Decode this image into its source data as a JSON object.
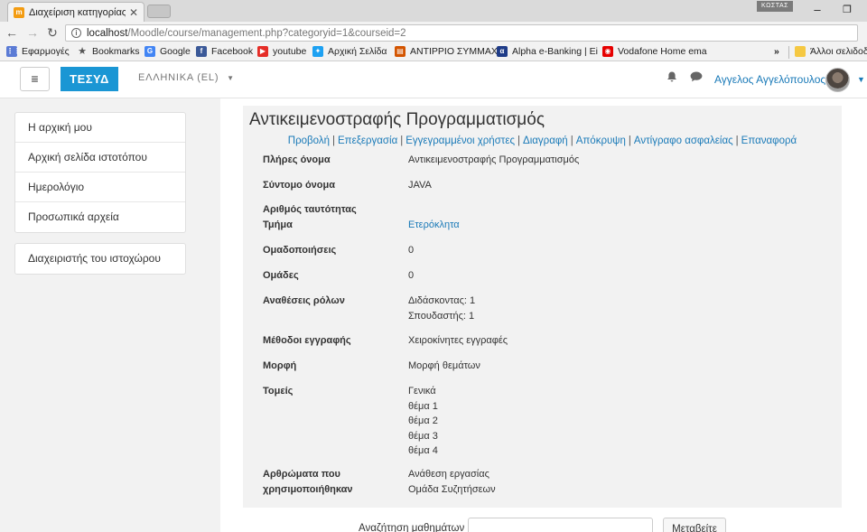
{
  "browser": {
    "tab_title": "Διαχείριση κατηγορίας κ",
    "profile_name": "ΚΩΣΤΑΣ",
    "url_host": "localhost",
    "url_path": "/Moodle/course/management.php?categoryid=1&courseid=2",
    "bookmarks": [
      {
        "label": "Εφαρμογές",
        "icon": "apps-grid-icon",
        "color": "#5b7bd5"
      },
      {
        "label": "Bookmarks",
        "icon": "star-icon",
        "color": "#555555"
      },
      {
        "label": "Google",
        "icon": "google-icon",
        "color": "#4285f4"
      },
      {
        "label": "Facebook",
        "icon": "facebook-icon",
        "color": "#3b5998"
      },
      {
        "label": "youtube",
        "icon": "youtube-icon",
        "color": "#e52d27"
      },
      {
        "label": "Αρχική Σελίδα",
        "icon": "twitter-icon",
        "color": "#1da1f2"
      },
      {
        "label": "ΑΝΤΙΡΡΙΟ ΣΥΜΜΑΧΙΑ",
        "icon": "folder-doc-icon",
        "color": "#d35400"
      },
      {
        "label": "Alpha e-Banking | Ei",
        "icon": "alpha-bank-icon",
        "color": "#1f3c88"
      },
      {
        "label": "Vodafone Home ema",
        "icon": "vodafone-icon",
        "color": "#e60000"
      }
    ],
    "overflow_label": "»",
    "other_bookmarks": "Άλλοι σελιδοδ"
  },
  "navbar": {
    "menu_icon": "≡",
    "brand": "ΤΕΣΥΔ",
    "language": "ΕΛΛΗΝΙΚΑ (EL)",
    "user_name": "Αγγελος Αγγελόπουλος"
  },
  "sidebar": {
    "items": [
      "Η αρχική μου",
      "Αρχική σελίδα ιστοτόπου",
      "Ημερολόγιο",
      "Προσωπικά αρχεία"
    ],
    "admin_item": "Διαχειριστής του ιστοχώρου"
  },
  "course": {
    "title": "Αντικειμενοστραφής Προγραμματισμός",
    "actions": [
      "Προβολή",
      "Επεξεργασία",
      "Εγγεγραμμένοι χρήστες",
      "Διαγραφή",
      "Απόκρυψη",
      "Αντίγραφο ασφαλείας",
      "Επαναφορά"
    ],
    "action_separator": "|",
    "fields": {
      "fullname": {
        "label": "Πλήρες όνομα",
        "value": "Αντικειμενοστραφής Προγραμματισμός"
      },
      "shortname": {
        "label": "Σύντομο όνομα",
        "value": "JAVA"
      },
      "idnumber": {
        "label": "Αριθμός ταυτότητας",
        "value": ""
      },
      "category": {
        "label": "Τμήμα",
        "value": "Ετερόκλητα"
      },
      "groupings": {
        "label": "Ομαδοποιήσεις",
        "value": "0"
      },
      "groups": {
        "label": "Ομάδες",
        "value": "0"
      },
      "roles": {
        "label": "Αναθέσεις ρόλων",
        "values": [
          "Διδάσκοντας: 1",
          "Σπουδαστής: 1"
        ]
      },
      "enrolment": {
        "label": "Μέθοδοι εγγραφής",
        "value": "Χειροκίνητες εγγραφές"
      },
      "format": {
        "label": "Μορφή",
        "value": "Μορφή θεμάτων"
      },
      "sections": {
        "label": "Τομείς",
        "values": [
          "Γενικά",
          "θέμα 1",
          "θέμα 2",
          "θέμα 3",
          "θέμα 4"
        ]
      },
      "modules": {
        "label": "Αρθρώματα που χρησιμοποιήθηκαν",
        "values": [
          "Ανάθεση εργασίας",
          "Ομάδα Συζητήσεων"
        ]
      }
    }
  },
  "search": {
    "label": "Αναζήτηση μαθημάτων",
    "button": "Μεταβείτε",
    "value": ""
  }
}
